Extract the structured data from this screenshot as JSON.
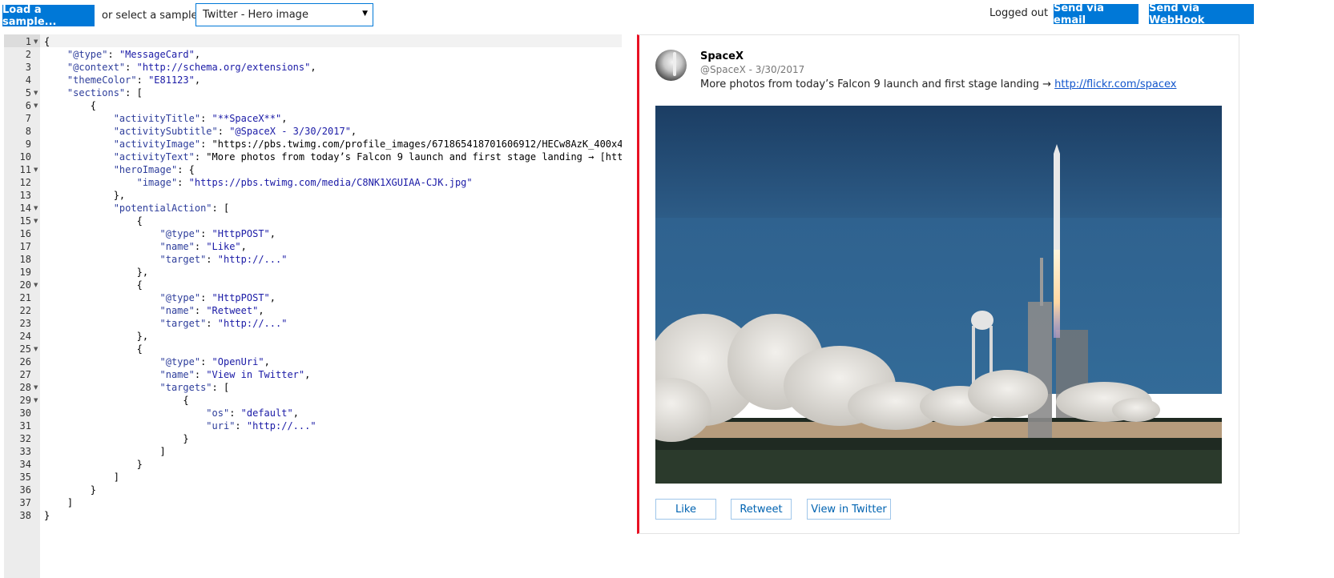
{
  "toolbar": {
    "load_label": "Load a sample...",
    "select_label": "or select a sample:",
    "select_value": "Twitter - Hero image",
    "logged_out": "Logged out",
    "email_label": "Send via email",
    "webhook_label": "Send via WebHook"
  },
  "editor": {
    "lines": [
      {
        "n": "1",
        "fold": true
      },
      {
        "n": "2"
      },
      {
        "n": "3"
      },
      {
        "n": "4"
      },
      {
        "n": "5",
        "fold": true
      },
      {
        "n": "6",
        "fold": true
      },
      {
        "n": "7"
      },
      {
        "n": "8"
      },
      {
        "n": "9"
      },
      {
        "n": "10"
      },
      {
        "n": "11",
        "fold": true
      },
      {
        "n": "12"
      },
      {
        "n": "13"
      },
      {
        "n": "14",
        "fold": true
      },
      {
        "n": "15",
        "fold": true
      },
      {
        "n": "16"
      },
      {
        "n": "17"
      },
      {
        "n": "18"
      },
      {
        "n": "19"
      },
      {
        "n": "20",
        "fold": true
      },
      {
        "n": "21"
      },
      {
        "n": "22"
      },
      {
        "n": "23"
      },
      {
        "n": "24"
      },
      {
        "n": "25",
        "fold": true
      },
      {
        "n": "26"
      },
      {
        "n": "27"
      },
      {
        "n": "28",
        "fold": true
      },
      {
        "n": "29",
        "fold": true
      },
      {
        "n": "30"
      },
      {
        "n": "31"
      },
      {
        "n": "32"
      },
      {
        "n": "33"
      },
      {
        "n": "34"
      },
      {
        "n": "35"
      },
      {
        "n": "36"
      },
      {
        "n": "37"
      },
      {
        "n": "38"
      }
    ],
    "code": [
      "{",
      "    \"@type\": \"MessageCard\",",
      "    \"@context\": \"http://schema.org/extensions\",",
      "    \"themeColor\": \"E81123\",",
      "    \"sections\": [",
      "        {",
      "            \"activityTitle\": \"**SpaceX**\",",
      "            \"activitySubtitle\": \"@SpaceX - 3/30/2017\",",
      "            \"activityImage\": \"https://pbs.twimg.com/profile_images/671865418701606912/HECw8AzK_400x4",
      "            \"activityText\": \"More photos from today’s Falcon 9 launch and first stage landing → [htt",
      "            \"heroImage\": {",
      "                \"image\": \"https://pbs.twimg.com/media/C8NK1XGUIAA-CJK.jpg\"",
      "            },",
      "            \"potentialAction\": [",
      "                {",
      "                    \"@type\": \"HttpPOST\",",
      "                    \"name\": \"Like\",",
      "                    \"target\": \"http://...\"",
      "                },",
      "                {",
      "                    \"@type\": \"HttpPOST\",",
      "                    \"name\": \"Retweet\",",
      "                    \"target\": \"http://...\"",
      "                },",
      "                {",
      "                    \"@type\": \"OpenUri\",",
      "                    \"name\": \"View in Twitter\",",
      "                    \"targets\": [",
      "                        {",
      "                            \"os\": \"default\",",
      "                            \"uri\": \"http://...\"",
      "                        }",
      "                    ]",
      "                }",
      "            ]",
      "        }",
      "    ]",
      "}"
    ]
  },
  "card": {
    "theme_color": "#E81123",
    "title": "SpaceX",
    "subtitle": "@SpaceX - 3/30/2017",
    "text_prefix": "More photos from today’s Falcon 9 launch and first stage landing → ",
    "link_text": "http://flickr.com/spacex",
    "actions": {
      "like": "Like",
      "retweet": "Retweet",
      "view": "View in Twitter"
    }
  }
}
